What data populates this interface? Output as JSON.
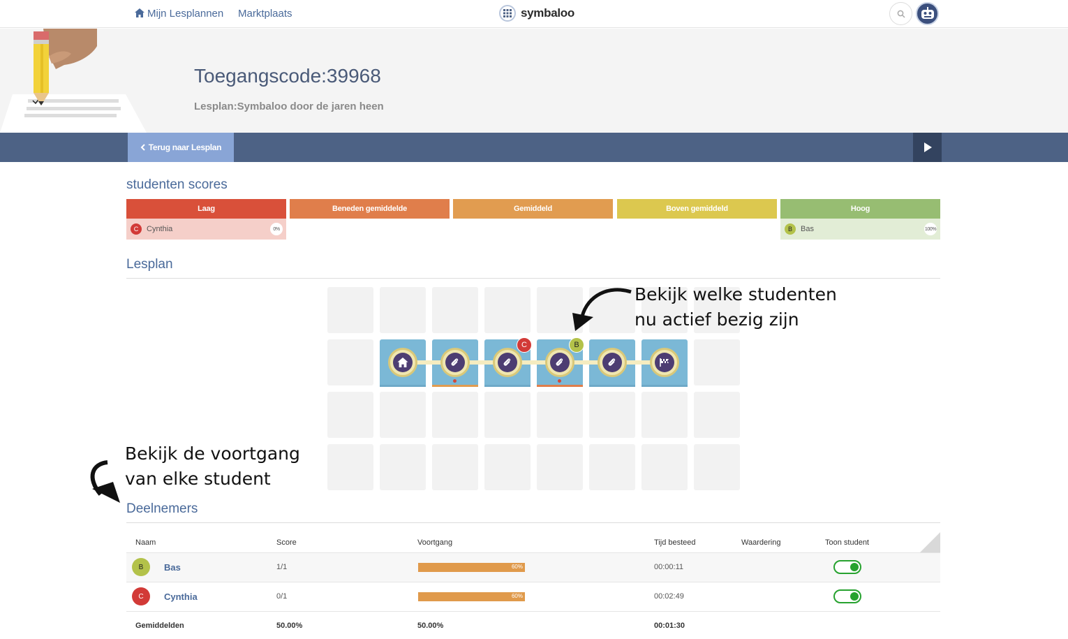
{
  "nav": {
    "home_label": "Mijn Lesplannen",
    "market_label": "Marktplaats",
    "logo_text": "symbaloo"
  },
  "header": {
    "title": "Toegangscode:39968",
    "subtitle": "Lesplan:Symbaloo door de jaren heen"
  },
  "actionbar": {
    "back_label": "Terug naar Lesplan"
  },
  "scores": {
    "title": "studenten scores",
    "buckets": [
      {
        "label": "Laag",
        "color": "#d9503a"
      },
      {
        "label": "Beneden gemiddelde",
        "color": "#e07e4b"
      },
      {
        "label": "Gemiddeld",
        "color": "#e19c50"
      },
      {
        "label": "Boven gemiddeld",
        "color": "#dcc84f"
      },
      {
        "label": "Hoog",
        "color": "#97bd72"
      }
    ],
    "students": [
      {
        "initial": "C",
        "name": "Cynthia",
        "percent": "0%",
        "bucket": "Laag"
      },
      {
        "initial": "B",
        "name": "Bas",
        "percent": "100%",
        "bucket": "Hoog"
      }
    ]
  },
  "lesplan": {
    "title": "Lesplan",
    "active_badges": [
      {
        "initial": "C",
        "tile": "tile-3"
      },
      {
        "initial": "B",
        "tile": "tile-4"
      }
    ]
  },
  "annotations": {
    "top_line1": "Bekijk welke studenten",
    "top_line2": "nu actief bezig zijn",
    "bottom_line1": "Bekijk de voortgang",
    "bottom_line2": "van elke student"
  },
  "participants": {
    "title": "Deelnemers",
    "columns": [
      "Naam",
      "Score",
      "Voortgang",
      "Tijd besteed",
      "Waardering",
      "Toon student"
    ],
    "rows": [
      {
        "initial": "B",
        "name": "Bas",
        "score": "1/1",
        "progress": 0.6,
        "progress_label": "60%",
        "time": "00:00:11",
        "show": true
      },
      {
        "initial": "C",
        "name": "Cynthia",
        "score": "0/1",
        "progress": 0.6,
        "progress_label": "60%",
        "time": "00:02:49",
        "show": true
      }
    ],
    "footer": {
      "label": "Gemiddelden",
      "score": "50.00%",
      "progress": "50.00%",
      "time": "00:01:30"
    }
  },
  "colors": {
    "avatar_b": "#b3c24a",
    "avatar_c": "#d23a37",
    "accent": "#4a6a9a"
  }
}
